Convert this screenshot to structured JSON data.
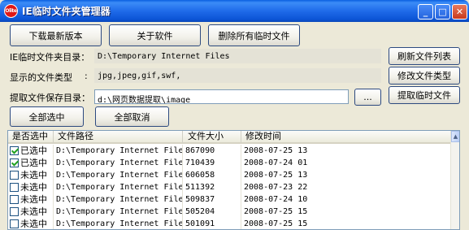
{
  "window": {
    "logo_text": "Olite",
    "title": "IE临时文件夹管理器",
    "minimize": "_",
    "maximize": "□",
    "close": "✕"
  },
  "toolbar": {
    "download": "下载最新版本",
    "about": "关于软件",
    "delete_all": "删除所有临时文件"
  },
  "form": {
    "temp_dir_label": "IE临时文件夹目录：",
    "temp_dir_value": "D:\\Temporary Internet Files",
    "refresh_button": "刷新文件列表",
    "types_label": "显示的文件类型",
    "types_colon": ":",
    "types_value": "jpg,jpeg,gif,swf,",
    "modify_types_button": "修改文件类型",
    "save_dir_label": "提取文件保存目录：",
    "save_dir_value": "d:\\网页数据提取\\image",
    "browse_button": "...",
    "extract_button": "提取临时文件"
  },
  "selection": {
    "select_all": "全部选中",
    "deselect_all": "全部取消"
  },
  "table": {
    "columns": [
      "是否选中",
      "文件路径",
      "文件大小",
      "修改时间"
    ],
    "rows": [
      {
        "checked": true,
        "status": "已选中",
        "path": "D:\\Temporary Internet Files\\C",
        "size": "867090",
        "time": "2008-07-25 13"
      },
      {
        "checked": true,
        "status": "已选中",
        "path": "D:\\Temporary Internet Files\\C",
        "size": "710439",
        "time": "2008-07-24 01"
      },
      {
        "checked": false,
        "status": "未选中",
        "path": "D:\\Temporary Internet Files\\C",
        "size": "606058",
        "time": "2008-07-25 13"
      },
      {
        "checked": false,
        "status": "未选中",
        "path": "D:\\Temporary Internet Files\\C",
        "size": "511392",
        "time": "2008-07-23 22"
      },
      {
        "checked": false,
        "status": "未选中",
        "path": "D:\\Temporary Internet Files\\C",
        "size": "509837",
        "time": "2008-07-24 10"
      },
      {
        "checked": false,
        "status": "未选中",
        "path": "D:\\Temporary Internet Files\\C",
        "size": "505204",
        "time": "2008-07-25 15"
      },
      {
        "checked": false,
        "status": "未选中",
        "path": "D:\\Temporary Internet Files\\C",
        "size": "501091",
        "time": "2008-07-25 15"
      }
    ]
  },
  "scrollbar": {
    "up_arrow": "▲"
  }
}
